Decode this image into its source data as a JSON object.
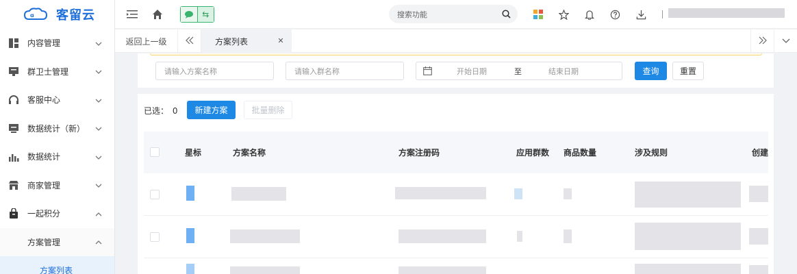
{
  "brand": {
    "name": "客留云"
  },
  "sidebar": {
    "items": [
      {
        "label": "内容管理",
        "icon": "grid-icon"
      },
      {
        "label": "群卫士管理",
        "icon": "monitor-icon"
      },
      {
        "label": "客服中心",
        "icon": "headset-icon"
      },
      {
        "label": "数据统计（新）",
        "icon": "chart-screen-icon"
      },
      {
        "label": "数据统计",
        "icon": "bar-chart-icon"
      },
      {
        "label": "商家管理",
        "icon": "store-icon"
      },
      {
        "label": "一起积分",
        "icon": "bag-icon"
      }
    ],
    "sub_item": "方案管理",
    "leaf_item": "方案列表"
  },
  "header": {
    "search_placeholder": "搜索功能",
    "pill_right": "⇆"
  },
  "tabs": {
    "back": "返回上一级",
    "active": "方案列表"
  },
  "filters": {
    "plan_name_placeholder": "请输入方案名称",
    "group_name_placeholder": "请输入群名称",
    "start_date": "开始日期",
    "range_sep": "至",
    "end_date": "结束日期",
    "query": "查询",
    "reset": "重置"
  },
  "table": {
    "selected_label": "已选：",
    "selected_count": "0",
    "new_button": "新建方案",
    "batch_delete": "批量删除",
    "columns": [
      "星标",
      "方案名称",
      "方案注册码",
      "应用群数",
      "商品数量",
      "涉及规则",
      "创建"
    ]
  },
  "colors": {
    "primary": "#1e88e5",
    "brand": "#1e6fd9",
    "active_bg": "#e8f2fd"
  }
}
